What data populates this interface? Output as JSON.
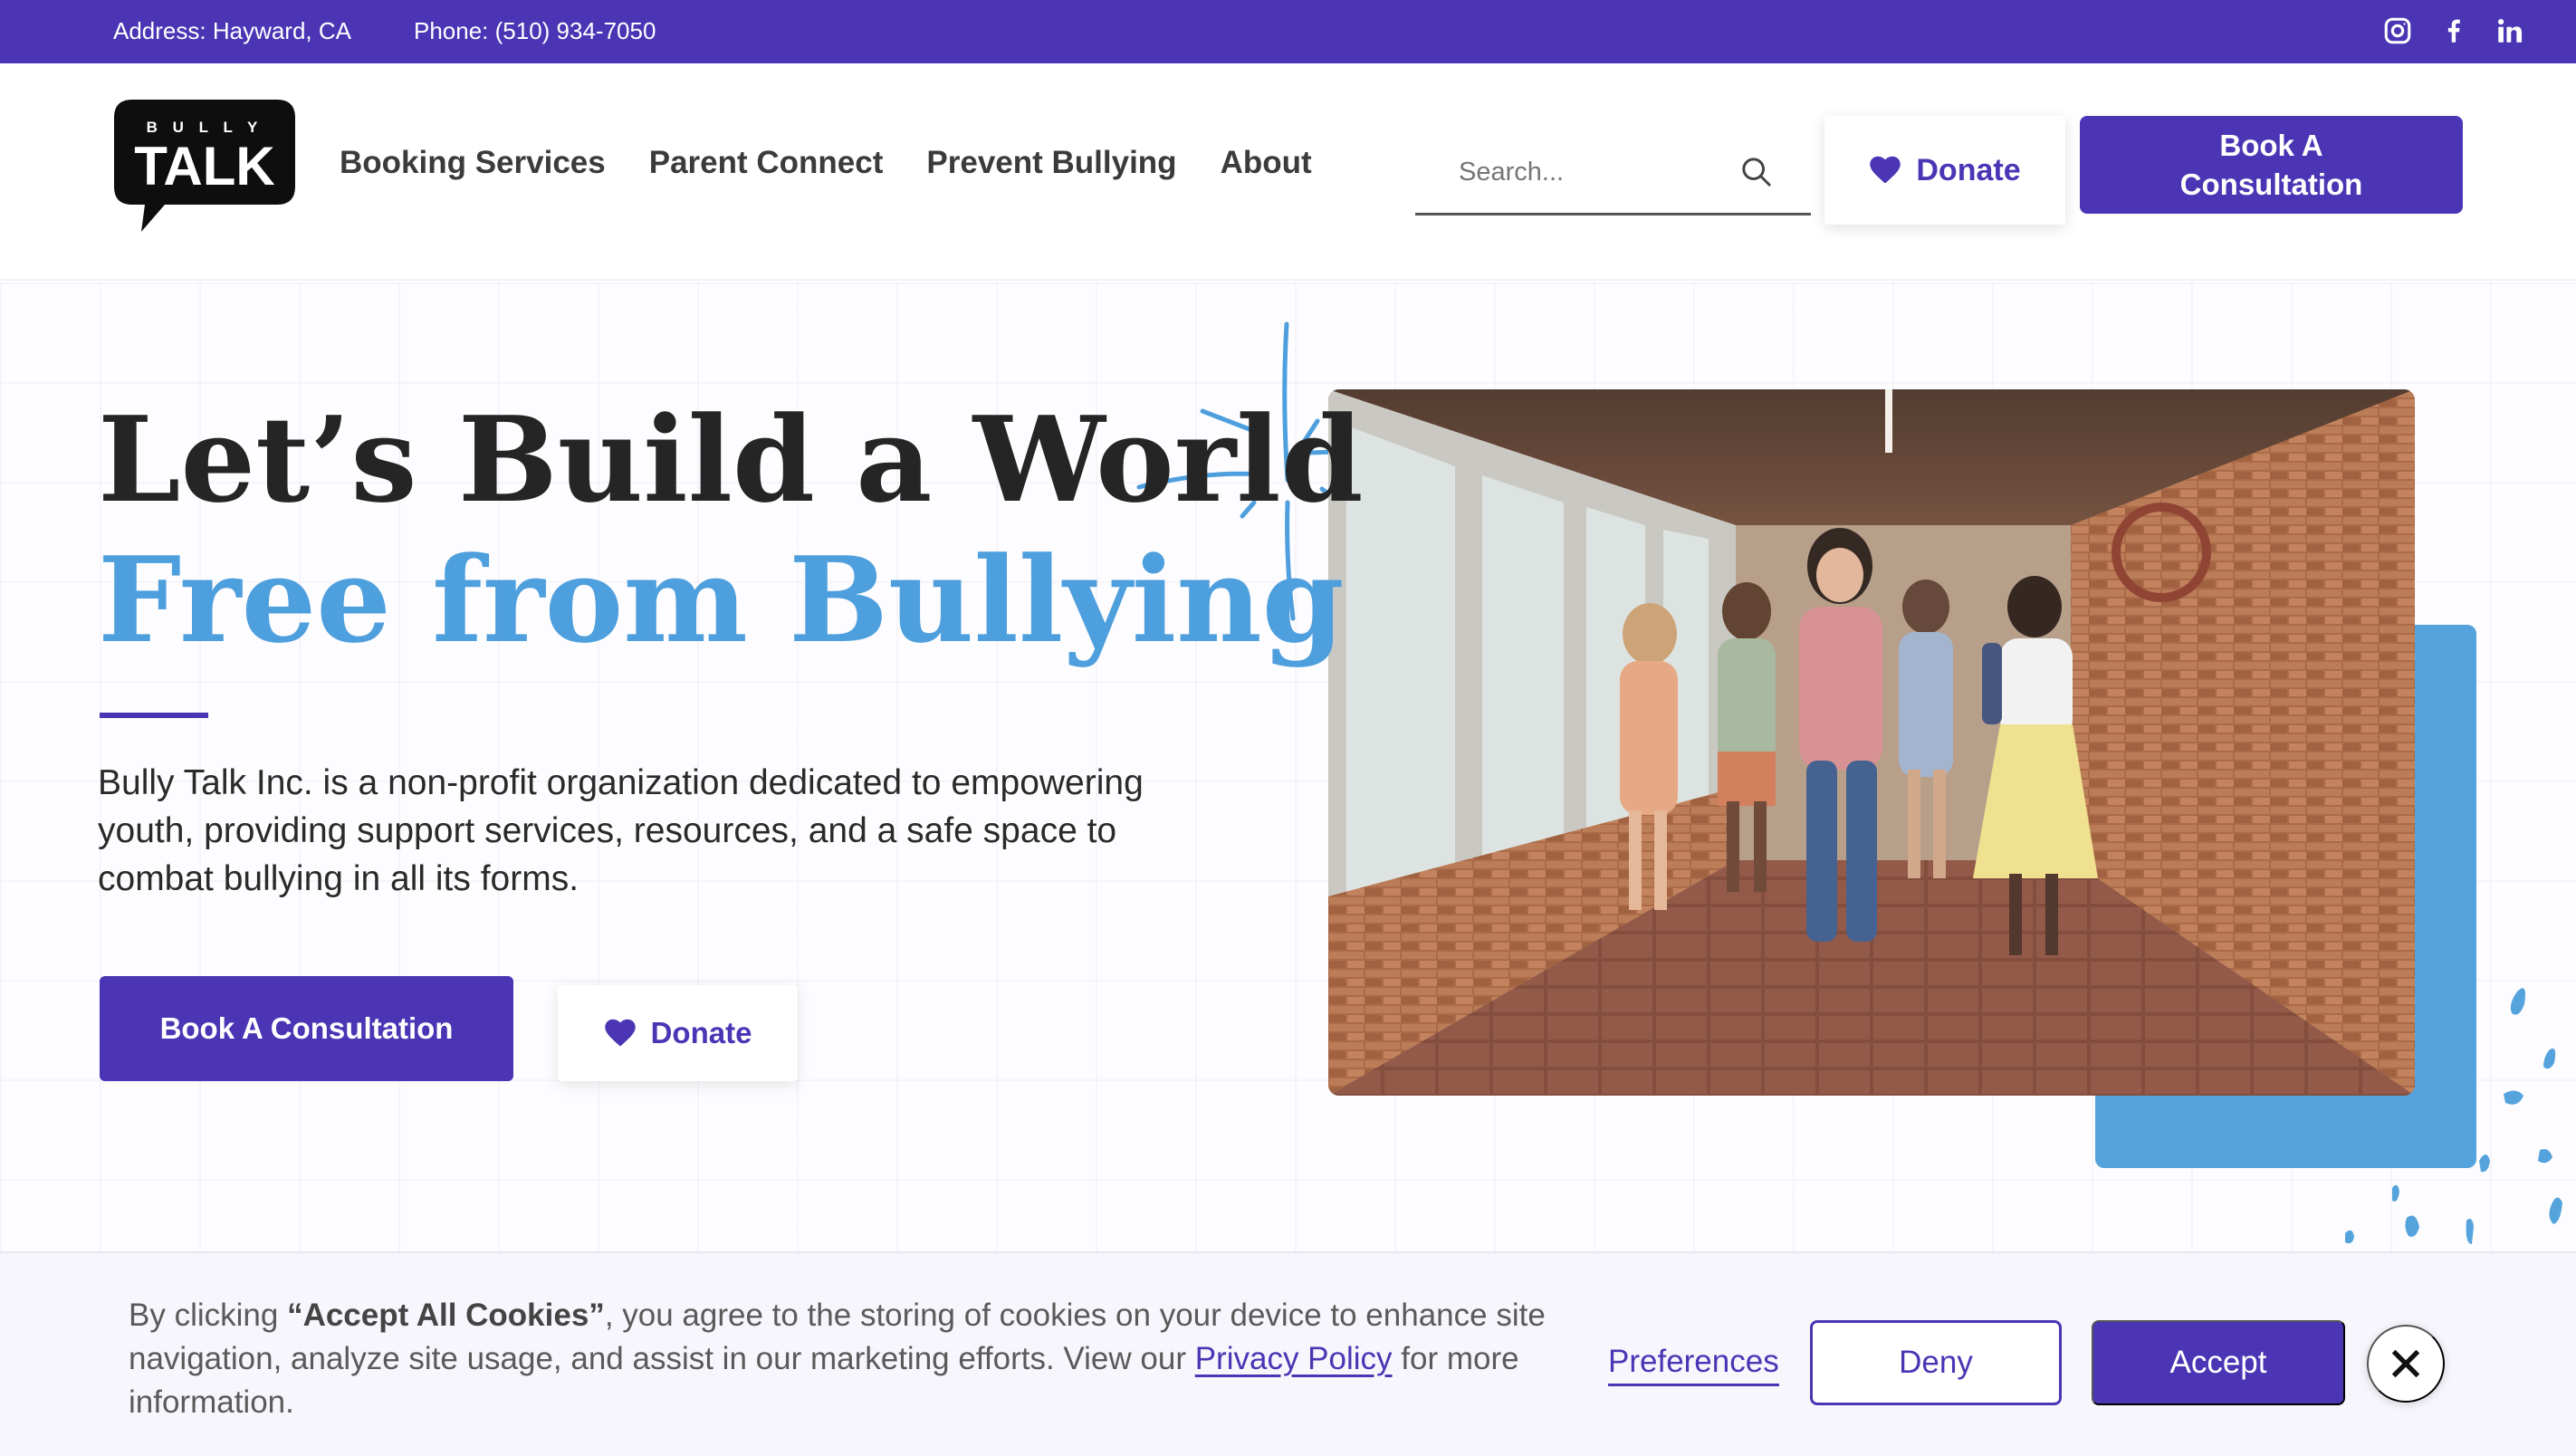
{
  "topbar": {
    "address": "Address: Hayward, CA",
    "phone": "Phone: (510) 934-7050",
    "social": [
      "instagram-icon",
      "facebook-icon",
      "linkedin-icon"
    ]
  },
  "logo": {
    "small_text": "B U L L Y",
    "big_text": "TALK"
  },
  "nav": {
    "items": [
      {
        "label": "Booking Services"
      },
      {
        "label": "Parent Connect"
      },
      {
        "label": "Prevent Bullying"
      },
      {
        "label": "About"
      }
    ]
  },
  "search": {
    "placeholder": "Search..."
  },
  "header_actions": {
    "donate_label": "Donate",
    "book_label": "Book A\nConsultation"
  },
  "hero": {
    "title_line1": "Let’s Build a World",
    "title_line2": "Free from Bullying",
    "description": "Bully Talk Inc. is a non-profit organization dedicated to empowering youth, providing support services, resources, and a safe space to combat bullying in all its forms.",
    "book_label": "Book A Consultation",
    "donate_label": "Donate"
  },
  "cookie": {
    "text_before": "By clicking ",
    "text_bold": "“Accept All Cookies”",
    "text_middle": ", you agree to the storing of cookies on your device to enhance site navigation, analyze site usage, and assist in our marketing efforts. View our ",
    "privacy_link": "Privacy Policy",
    "text_after": " for more information.",
    "preferences_label": "Preferences",
    "deny_label": "Deny",
    "accept_label": "Accept"
  },
  "colors": {
    "primary": "#4b35b5",
    "accent_blue": "#4e9fdd",
    "heading": "#252525"
  }
}
